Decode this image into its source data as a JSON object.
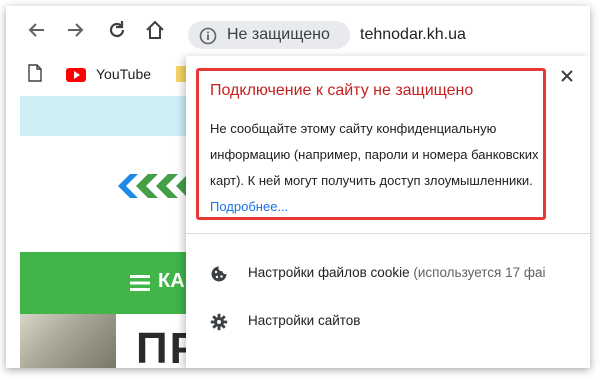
{
  "browser": {
    "security_chip": "Не защищено",
    "url": "tehnodar.kh.ua"
  },
  "bookmarks": {
    "items": [
      {
        "label": "YouTube"
      }
    ]
  },
  "page": {
    "menu_label": "КА",
    "headline": "ПР"
  },
  "popup": {
    "title": "Подключение к сайту не защищено",
    "body": "Не сообщайте этому сайту конфиденциальную информацию (например, пароли и номера банковских карт). К ней могут получить доступ злоумышленники.",
    "link": "Подробнее...",
    "settings": [
      {
        "label": "Настройки файлов cookie",
        "sub": "(используется 17 фаі"
      },
      {
        "label": "Настройки сайтов",
        "sub": ""
      }
    ]
  },
  "colors": {
    "warning_red": "#e53935",
    "link_blue": "#1a73e8",
    "page_green": "#41b549"
  }
}
